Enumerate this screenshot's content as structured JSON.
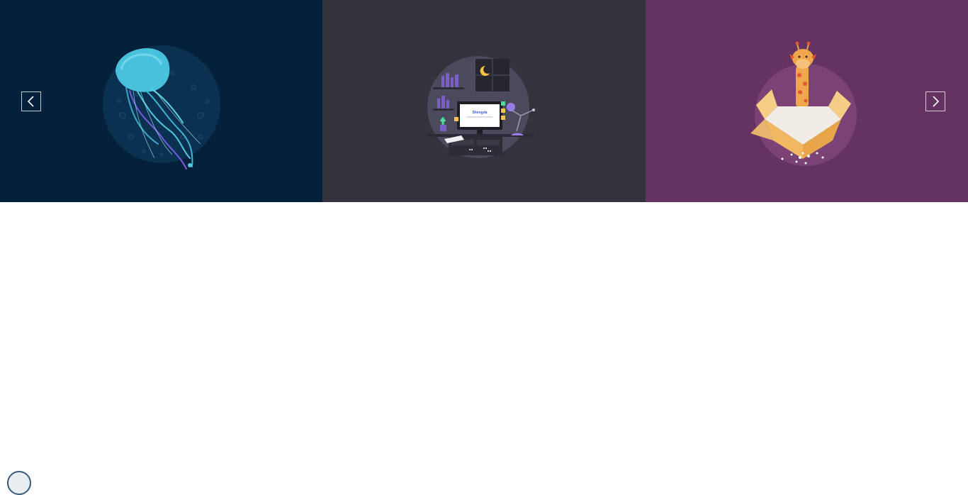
{
  "colors": {
    "slide_1_bg": "#04203a",
    "slide_2_bg": "#33333e",
    "slide_3_bg": "#643361",
    "page_bg": "#ffffff"
  },
  "carousel": {
    "slides": [
      {
        "illustration": "jellyfish-illustration"
      },
      {
        "illustration": "night-desk-computer-illustration"
      },
      {
        "illustration": "giraffe-in-box-illustration"
      }
    ],
    "prev_icon": "chevron-left-icon",
    "next_icon": "chevron-right-icon"
  },
  "monitor_screen_text": "Shengda",
  "corner_widget_icon": "circle-avatar-icon"
}
